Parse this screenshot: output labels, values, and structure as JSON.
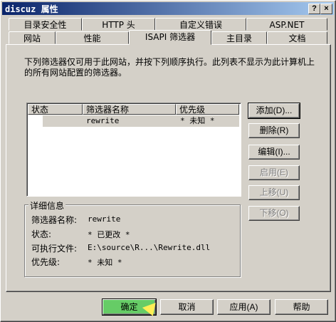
{
  "window": {
    "title": "discuz 属性",
    "help_glyph": "?",
    "close_glyph": "×"
  },
  "tabs_back": [
    "目录安全性",
    "HTTP 头",
    "自定义错误",
    "ASP.NET"
  ],
  "tabs_front": [
    "网站",
    "性能",
    "ISAPI 筛选器",
    "主目录",
    "文档"
  ],
  "description": "下列筛选器仅可用于此网站，并按下列顺序执行。此列表不显示为此计算机上的所有网站配置的筛选器。",
  "list": {
    "columns": [
      "状态",
      "筛选器名称",
      "优先级"
    ],
    "rows": [
      {
        "status": "",
        "name": "rewrite",
        "priority": "* 未知 *"
      }
    ]
  },
  "side_buttons": {
    "add": "添加(D)...",
    "remove": "删除(R)",
    "edit": "编辑(I)...",
    "enable": "启用(E)",
    "move_up": "上移(U)",
    "move_down": "下移(O)"
  },
  "details": {
    "title": "详细信息",
    "name_label": "筛选器名称:",
    "name_value": "rewrite",
    "status_label": "状态:",
    "status_value": "* 已更改 *",
    "exe_label": "可执行文件:",
    "exe_value": "E:\\source\\R...\\Rewrite.dll",
    "priority_label": "优先级:",
    "priority_value": "* 未知 *"
  },
  "bottom_buttons": {
    "ok": "确定",
    "cancel": "取消",
    "apply": "应用(A)",
    "help": "帮助"
  }
}
